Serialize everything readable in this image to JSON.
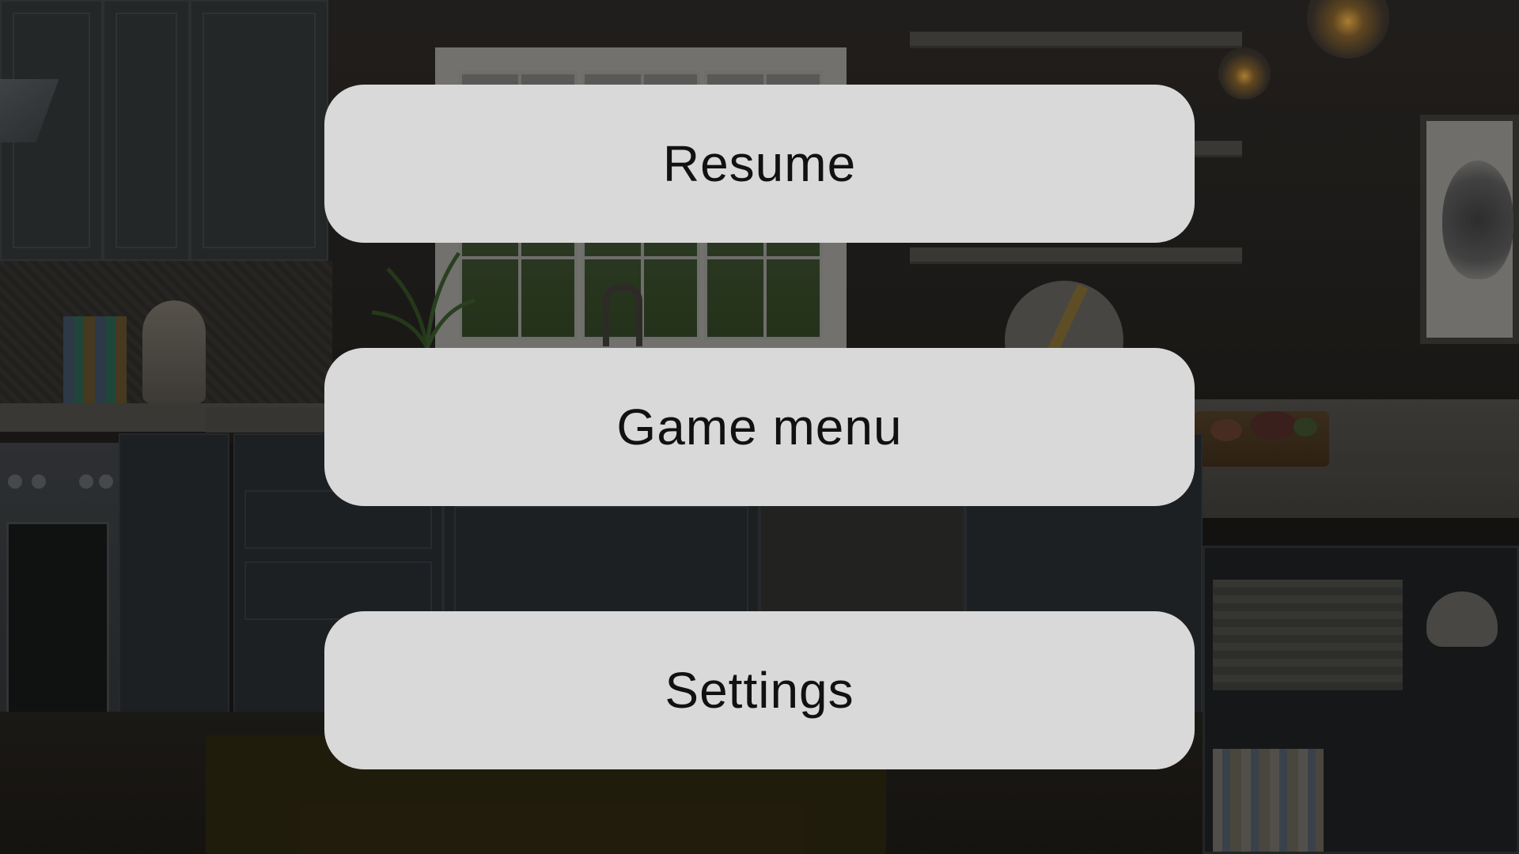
{
  "pause_menu": {
    "buttons": [
      {
        "id": "resume",
        "label": "Resume"
      },
      {
        "id": "game_menu",
        "label": "Game menu"
      },
      {
        "id": "settings",
        "label": "Settings"
      }
    ]
  },
  "background": {
    "scene": "dimmed kitchen interior"
  },
  "colors": {
    "button_fill": "#d9d9d9",
    "button_text": "#111111"
  }
}
